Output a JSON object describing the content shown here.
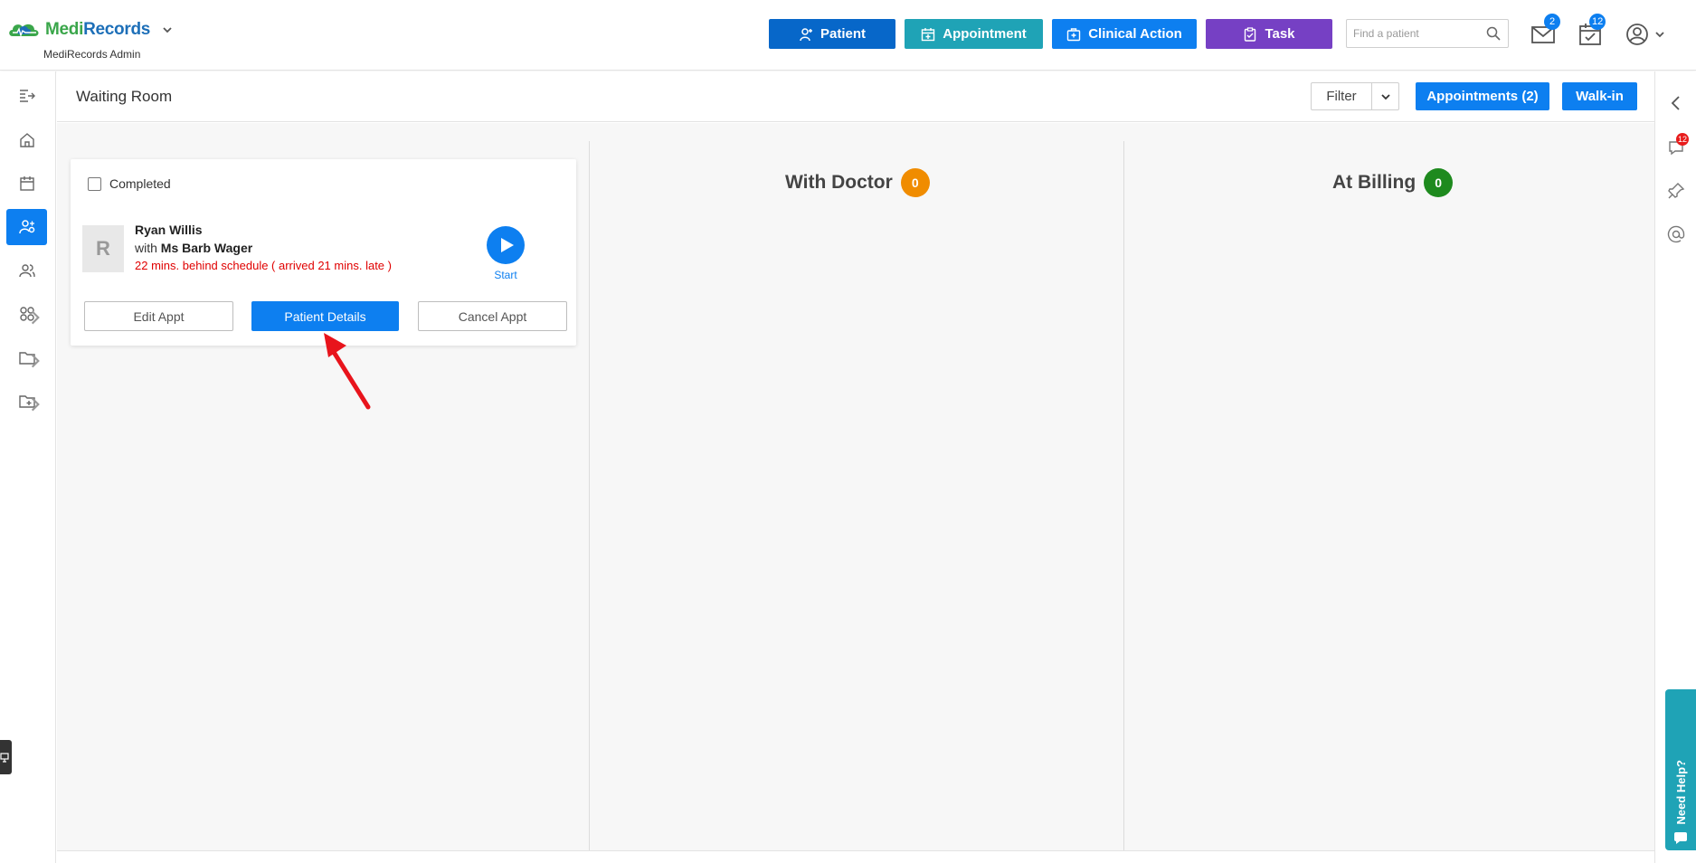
{
  "app": {
    "logo_medi": "Medi",
    "logo_records": "Records",
    "subtitle": "MediRecords Admin"
  },
  "header": {
    "buttons": {
      "patient": "Patient",
      "appointment": "Appointment",
      "clinical_action": "Clinical Action",
      "task": "Task"
    },
    "search_placeholder": "Find a patient",
    "mail_badge": "2",
    "tasks_badge": "12"
  },
  "page": {
    "title": "Waiting Room",
    "filter_label": "Filter",
    "appointments_label": "Appointments (2)",
    "walkin_label": "Walk-in"
  },
  "board": {
    "columns": [
      {
        "title": "With Doctor",
        "count": "0",
        "color": "#f08c00"
      },
      {
        "title": "At Billing",
        "count": "0",
        "color": "#1e8a1e"
      }
    ]
  },
  "card": {
    "completed_label": "Completed",
    "avatar_initial": "R",
    "patient_name": "Ryan Willis",
    "with_prefix": "with",
    "doctor": "Ms Barb Wager",
    "status": "22 mins. behind schedule ( arrived 21 mins. late )",
    "start_label": "Start",
    "edit_label": "Edit Appt",
    "details_label": "Patient Details",
    "cancel_label": "Cancel Appt"
  },
  "right_rail": {
    "chat_badge": "12",
    "need_help": "Need Help?"
  },
  "colors": {
    "primary": "#0d7ff0",
    "patient_btn": "#0767c9",
    "appointment_btn": "#1fa3b6",
    "task_btn": "#7640c4",
    "late_text": "#e00000",
    "annotation_arrow": "#e8141c"
  }
}
